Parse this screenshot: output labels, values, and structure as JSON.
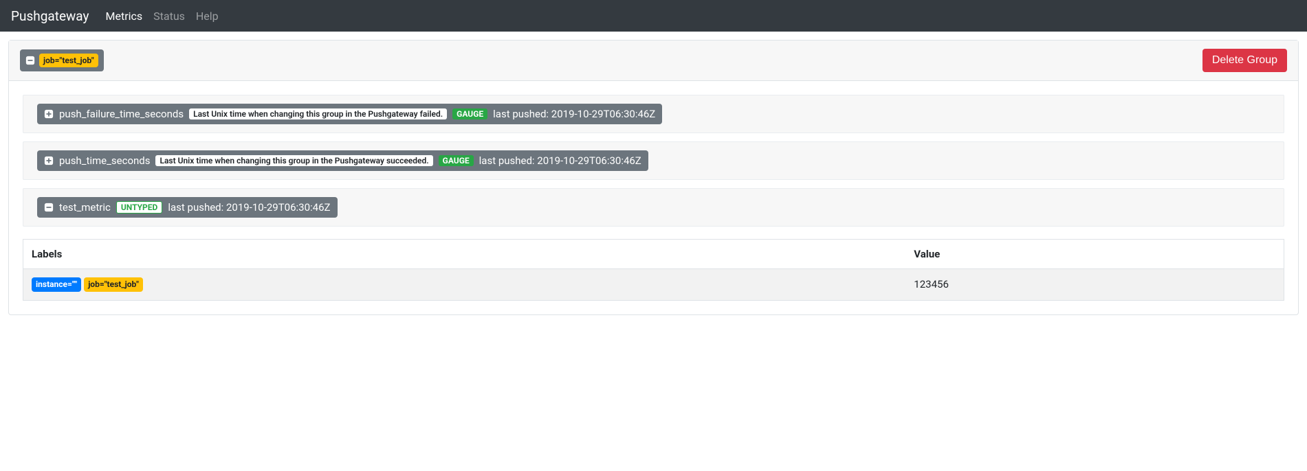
{
  "nav": {
    "brand": "Pushgateway",
    "links": [
      {
        "label": "Metrics",
        "active": true
      },
      {
        "label": "Status",
        "active": false
      },
      {
        "label": "Help",
        "active": false
      }
    ]
  },
  "group": {
    "labels": [
      {
        "text": "job=\"test_job\"",
        "style": "yellow"
      }
    ],
    "delete_label": "Delete Group"
  },
  "metrics": [
    {
      "name": "push_failure_time_seconds",
      "help": "Last Unix time when changing this group in the Pushgateway failed.",
      "type": "GAUGE",
      "type_style": "gauge",
      "pushed": "last pushed: 2019-10-29T06:30:46Z",
      "expanded": false
    },
    {
      "name": "push_time_seconds",
      "help": "Last Unix time when changing this group in the Pushgateway succeeded.",
      "type": "GAUGE",
      "type_style": "gauge",
      "pushed": "last pushed: 2019-10-29T06:30:46Z",
      "expanded": false
    },
    {
      "name": "test_metric",
      "help": "",
      "type": "UNTYPED",
      "type_style": "untyped",
      "pushed": "last pushed: 2019-10-29T06:30:46Z",
      "expanded": true
    }
  ],
  "table": {
    "headers": {
      "labels": "Labels",
      "value": "Value"
    },
    "rows": [
      {
        "labels": [
          {
            "text": "instance=\"\"",
            "style": "blue"
          },
          {
            "text": "job=\"test_job\"",
            "style": "yellow"
          }
        ],
        "value": "123456"
      }
    ]
  }
}
